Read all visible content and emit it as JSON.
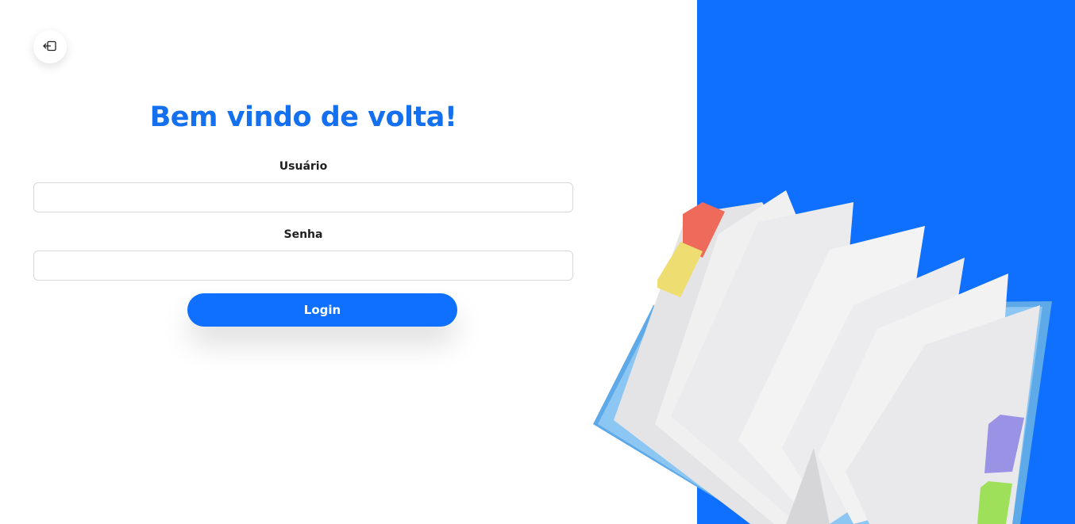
{
  "header": {
    "back_icon": "logout-arrow-icon"
  },
  "login": {
    "title": "Bem vindo de volta!",
    "username_label": "Usuário",
    "username_value": "",
    "password_label": "Senha",
    "password_value": "",
    "submit_label": "Login"
  },
  "illustration": {
    "subject": "open-notebook-icon"
  },
  "colors": {
    "accent": "#0f6fff",
    "title": "#1470ee",
    "background": "#ffffff"
  }
}
